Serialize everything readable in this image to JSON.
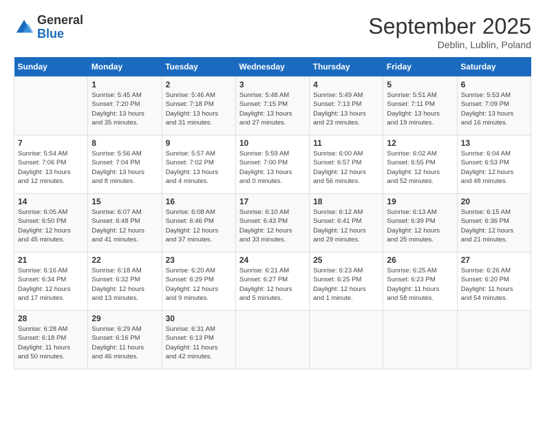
{
  "header": {
    "logo_general": "General",
    "logo_blue": "Blue",
    "month_title": "September 2025",
    "location": "Deblin, Lublin, Poland"
  },
  "days_of_week": [
    "Sunday",
    "Monday",
    "Tuesday",
    "Wednesday",
    "Thursday",
    "Friday",
    "Saturday"
  ],
  "weeks": [
    [
      {
        "day": "",
        "info": ""
      },
      {
        "day": "1",
        "info": "Sunrise: 5:45 AM\nSunset: 7:20 PM\nDaylight: 13 hours\nand 35 minutes."
      },
      {
        "day": "2",
        "info": "Sunrise: 5:46 AM\nSunset: 7:18 PM\nDaylight: 13 hours\nand 31 minutes."
      },
      {
        "day": "3",
        "info": "Sunrise: 5:48 AM\nSunset: 7:15 PM\nDaylight: 13 hours\nand 27 minutes."
      },
      {
        "day": "4",
        "info": "Sunrise: 5:49 AM\nSunset: 7:13 PM\nDaylight: 13 hours\nand 23 minutes."
      },
      {
        "day": "5",
        "info": "Sunrise: 5:51 AM\nSunset: 7:11 PM\nDaylight: 13 hours\nand 19 minutes."
      },
      {
        "day": "6",
        "info": "Sunrise: 5:53 AM\nSunset: 7:09 PM\nDaylight: 13 hours\nand 16 minutes."
      }
    ],
    [
      {
        "day": "7",
        "info": "Sunrise: 5:54 AM\nSunset: 7:06 PM\nDaylight: 13 hours\nand 12 minutes."
      },
      {
        "day": "8",
        "info": "Sunrise: 5:56 AM\nSunset: 7:04 PM\nDaylight: 13 hours\nand 8 minutes."
      },
      {
        "day": "9",
        "info": "Sunrise: 5:57 AM\nSunset: 7:02 PM\nDaylight: 13 hours\nand 4 minutes."
      },
      {
        "day": "10",
        "info": "Sunrise: 5:59 AM\nSunset: 7:00 PM\nDaylight: 13 hours\nand 0 minutes."
      },
      {
        "day": "11",
        "info": "Sunrise: 6:00 AM\nSunset: 6:57 PM\nDaylight: 12 hours\nand 56 minutes."
      },
      {
        "day": "12",
        "info": "Sunrise: 6:02 AM\nSunset: 6:55 PM\nDaylight: 12 hours\nand 52 minutes."
      },
      {
        "day": "13",
        "info": "Sunrise: 6:04 AM\nSunset: 6:53 PM\nDaylight: 12 hours\nand 48 minutes."
      }
    ],
    [
      {
        "day": "14",
        "info": "Sunrise: 6:05 AM\nSunset: 6:50 PM\nDaylight: 12 hours\nand 45 minutes."
      },
      {
        "day": "15",
        "info": "Sunrise: 6:07 AM\nSunset: 6:48 PM\nDaylight: 12 hours\nand 41 minutes."
      },
      {
        "day": "16",
        "info": "Sunrise: 6:08 AM\nSunset: 6:46 PM\nDaylight: 12 hours\nand 37 minutes."
      },
      {
        "day": "17",
        "info": "Sunrise: 6:10 AM\nSunset: 6:43 PM\nDaylight: 12 hours\nand 33 minutes."
      },
      {
        "day": "18",
        "info": "Sunrise: 6:12 AM\nSunset: 6:41 PM\nDaylight: 12 hours\nand 29 minutes."
      },
      {
        "day": "19",
        "info": "Sunrise: 6:13 AM\nSunset: 6:39 PM\nDaylight: 12 hours\nand 25 minutes."
      },
      {
        "day": "20",
        "info": "Sunrise: 6:15 AM\nSunset: 6:36 PM\nDaylight: 12 hours\nand 21 minutes."
      }
    ],
    [
      {
        "day": "21",
        "info": "Sunrise: 6:16 AM\nSunset: 6:34 PM\nDaylight: 12 hours\nand 17 minutes."
      },
      {
        "day": "22",
        "info": "Sunrise: 6:18 AM\nSunset: 6:32 PM\nDaylight: 12 hours\nand 13 minutes."
      },
      {
        "day": "23",
        "info": "Sunrise: 6:20 AM\nSunset: 6:29 PM\nDaylight: 12 hours\nand 9 minutes."
      },
      {
        "day": "24",
        "info": "Sunrise: 6:21 AM\nSunset: 6:27 PM\nDaylight: 12 hours\nand 5 minutes."
      },
      {
        "day": "25",
        "info": "Sunrise: 6:23 AM\nSunset: 6:25 PM\nDaylight: 12 hours\nand 1 minute."
      },
      {
        "day": "26",
        "info": "Sunrise: 6:25 AM\nSunset: 6:23 PM\nDaylight: 11 hours\nand 58 minutes."
      },
      {
        "day": "27",
        "info": "Sunrise: 6:26 AM\nSunset: 6:20 PM\nDaylight: 11 hours\nand 54 minutes."
      }
    ],
    [
      {
        "day": "28",
        "info": "Sunrise: 6:28 AM\nSunset: 6:18 PM\nDaylight: 11 hours\nand 50 minutes."
      },
      {
        "day": "29",
        "info": "Sunrise: 6:29 AM\nSunset: 6:16 PM\nDaylight: 11 hours\nand 46 minutes."
      },
      {
        "day": "30",
        "info": "Sunrise: 6:31 AM\nSunset: 6:13 PM\nDaylight: 11 hours\nand 42 minutes."
      },
      {
        "day": "",
        "info": ""
      },
      {
        "day": "",
        "info": ""
      },
      {
        "day": "",
        "info": ""
      },
      {
        "day": "",
        "info": ""
      }
    ]
  ]
}
